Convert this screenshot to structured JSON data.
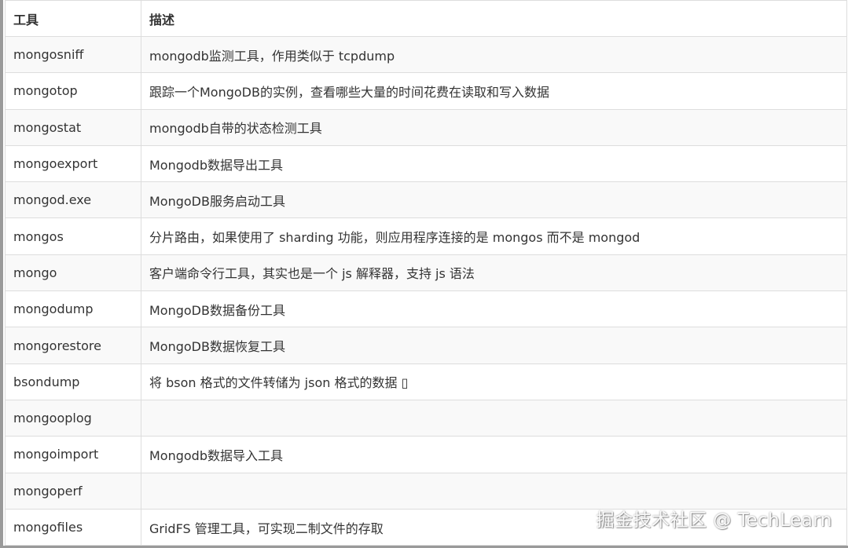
{
  "table": {
    "headers": {
      "tool": "工具",
      "description": "描述"
    },
    "rows": [
      {
        "tool": "mongosniff",
        "description": "mongodb监测工具，作用类似于 tcpdump"
      },
      {
        "tool": "mongotop",
        "description": "跟踪一个MongoDB的实例，查看哪些大量的时间花费在读取和写入数据"
      },
      {
        "tool": "mongostat",
        "description": "mongodb自带的状态检测工具"
      },
      {
        "tool": "mongoexport",
        "description": "Mongodb数据导出工具"
      },
      {
        "tool": "mongod.exe",
        "description": "MongoDB服务启动工具"
      },
      {
        "tool": "mongos",
        "description": "分片路由，如果使用了 sharding 功能，则应用程序连接的是 mongos 而不是 mongod"
      },
      {
        "tool": "mongo",
        "description": "客户端命令行工具，其实也是一个 js 解释器，支持 js 语法"
      },
      {
        "tool": "mongodump",
        "description": "MongoDB数据备份工具"
      },
      {
        "tool": "mongorestore",
        "description": "MongoDB数据恢复工具"
      },
      {
        "tool": "bsondump",
        "description": "将 bson 格式的文件转储为 json 格式的数据 ▯"
      },
      {
        "tool": "mongooplog",
        "description": ""
      },
      {
        "tool": "mongoimport",
        "description": "Mongodb数据导入工具"
      },
      {
        "tool": "mongoperf",
        "description": ""
      },
      {
        "tool": "mongofiles",
        "description": "GridFS 管理工具，可实现二制文件的存取"
      }
    ]
  },
  "watermark": "掘金技术社区 @ TechLearn",
  "colors": {
    "link": "#2c7fb8",
    "text": "#333333",
    "border": "#dddddd",
    "stripe": "#f9f9f9"
  }
}
